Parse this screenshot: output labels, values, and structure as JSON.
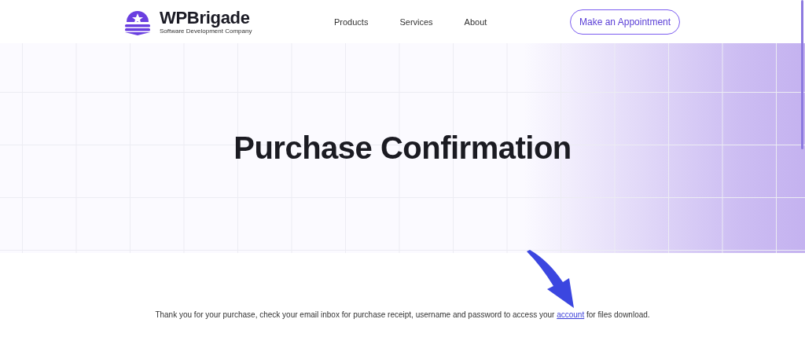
{
  "header": {
    "logo": {
      "name": "WPBrigade",
      "tagline": "Software Development Company"
    },
    "nav": [
      {
        "label": "Products"
      },
      {
        "label": "Services"
      },
      {
        "label": "About"
      }
    ],
    "cta": "Make an Appointment"
  },
  "hero": {
    "title": "Purchase Confirmation"
  },
  "message": {
    "before": "Thank you for your purchase, check your email inbox for purchase receipt, username and password to access your ",
    "link": "account",
    "after": " for files download."
  }
}
